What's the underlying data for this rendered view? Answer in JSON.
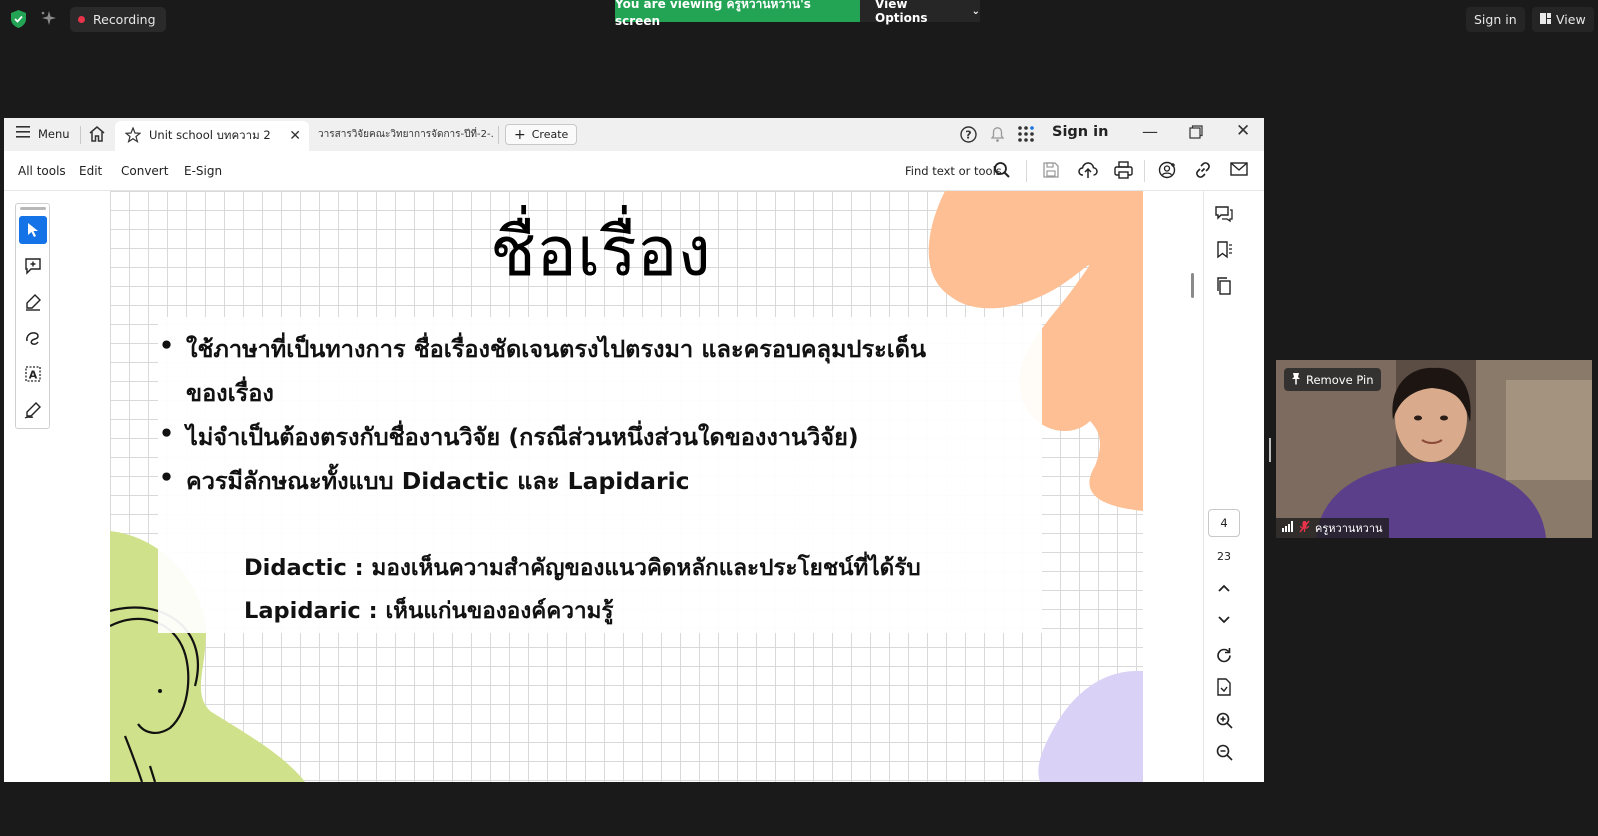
{
  "zoom": {
    "recording_label": "Recording",
    "banner_text": "You are viewing ครูหวานหวาน's screen",
    "view_options_label": "View Options",
    "sign_in_label": "Sign in",
    "view_label": "View"
  },
  "acrobat": {
    "menu_label": "Menu",
    "active_tab_title": "Unit school บทความ 2",
    "second_tab_title": "วารสารวิจัยคณะวิทยาการจัดการ-ปีที่-2-...",
    "create_label": "Create",
    "sign_in_label": "Sign in",
    "toolbar": {
      "all_tools": "All tools",
      "edit": "Edit",
      "convert": "Convert",
      "esign": "E-Sign",
      "find_placeholder": "Find text or tools"
    },
    "page_current": "4",
    "page_total": "23"
  },
  "slide": {
    "title": "ชื่อเรื่อง",
    "bullets": [
      "ใช้ภาษาที่เป็นทางการ ชื่อเรื่องชัดเจนตรงไปตรงมา และครอบคลุมประเด็น",
      "ของเรื่อง",
      "ไม่จำเป็นต้องตรงกับชื่องานวิจัย (กรณีส่วนหนึ่งส่วนใดของงานวิจัย)",
      "ควรมีลักษณะทั้งแบบ Didactic และ Lapidaric"
    ],
    "didactic": "Didactic : มองเห็นความสำคัญของแนวคิดหลักและประโยชน์ที่ได้รับ",
    "lapidaric": "Lapidaric : เห็นแก่นขององค์ความรู้"
  },
  "video": {
    "remove_pin_label": "Remove Pin",
    "participant_name": "ครูหวานหวาน"
  },
  "colors": {
    "share_banner": "#23a455",
    "accent_blue": "#1473e6",
    "blob_orange": "#fdbf93",
    "blob_green": "#cfe18a",
    "blob_lavender": "#d9d2f6"
  }
}
